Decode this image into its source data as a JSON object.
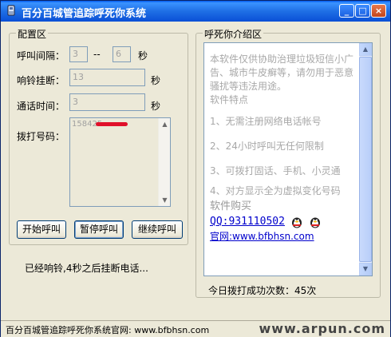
{
  "window": {
    "title": "百分百城管追踪呼死你系统",
    "minimize": "_",
    "maximize": "□",
    "close": "×"
  },
  "config": {
    "group_title": "配置区",
    "call_interval_label": "呼叫间隔：",
    "call_interval_min": "3",
    "call_interval_sep": "--",
    "call_interval_max": "6",
    "call_interval_unit": "秒",
    "ring_hangup_label": "响铃挂断：",
    "ring_hangup_value": "13",
    "ring_hangup_unit": "秒",
    "talk_time_label": "通话时间：",
    "talk_time_value": "3",
    "talk_time_unit": "秒",
    "dial_number_label": "拨打号码：",
    "dial_number_value": "158425"
  },
  "buttons": {
    "start": "开始呼叫",
    "pause": "暂停呼叫",
    "resume": "继续呼叫"
  },
  "status_message": "已经响铃,4秒之后挂断电话...",
  "intro": {
    "group_title": "呼死你介绍区",
    "paragraph1": "本软件仅供协助治理垃圾短信小广告、城市牛皮癣等，请勿用于恶意骚扰等违法用途。",
    "paragraph1b": "软件特点",
    "feature1": "1、无需注册网络电话帐号",
    "feature2": "2、24小时呼叫无任何限制",
    "feature3": "3、可拨打固话、手机、小灵通",
    "feature4": "4、对方显示全为虚拟变化号码",
    "buy_heading": "软件购买",
    "qq_text": "QQ:931110502",
    "website_text": "官网:www.bfbhsn.com"
  },
  "success_count": "今日拨打成功次数：45次",
  "statusbar": {
    "text": "百分百城管追踪呼死你系统官网: www.bfbhsn.com",
    "watermark": "www.arpun.com"
  },
  "colors": {
    "titlebar": "#0a4fd6",
    "link_blue": "#0000cc",
    "redaction": "#e0102a"
  }
}
